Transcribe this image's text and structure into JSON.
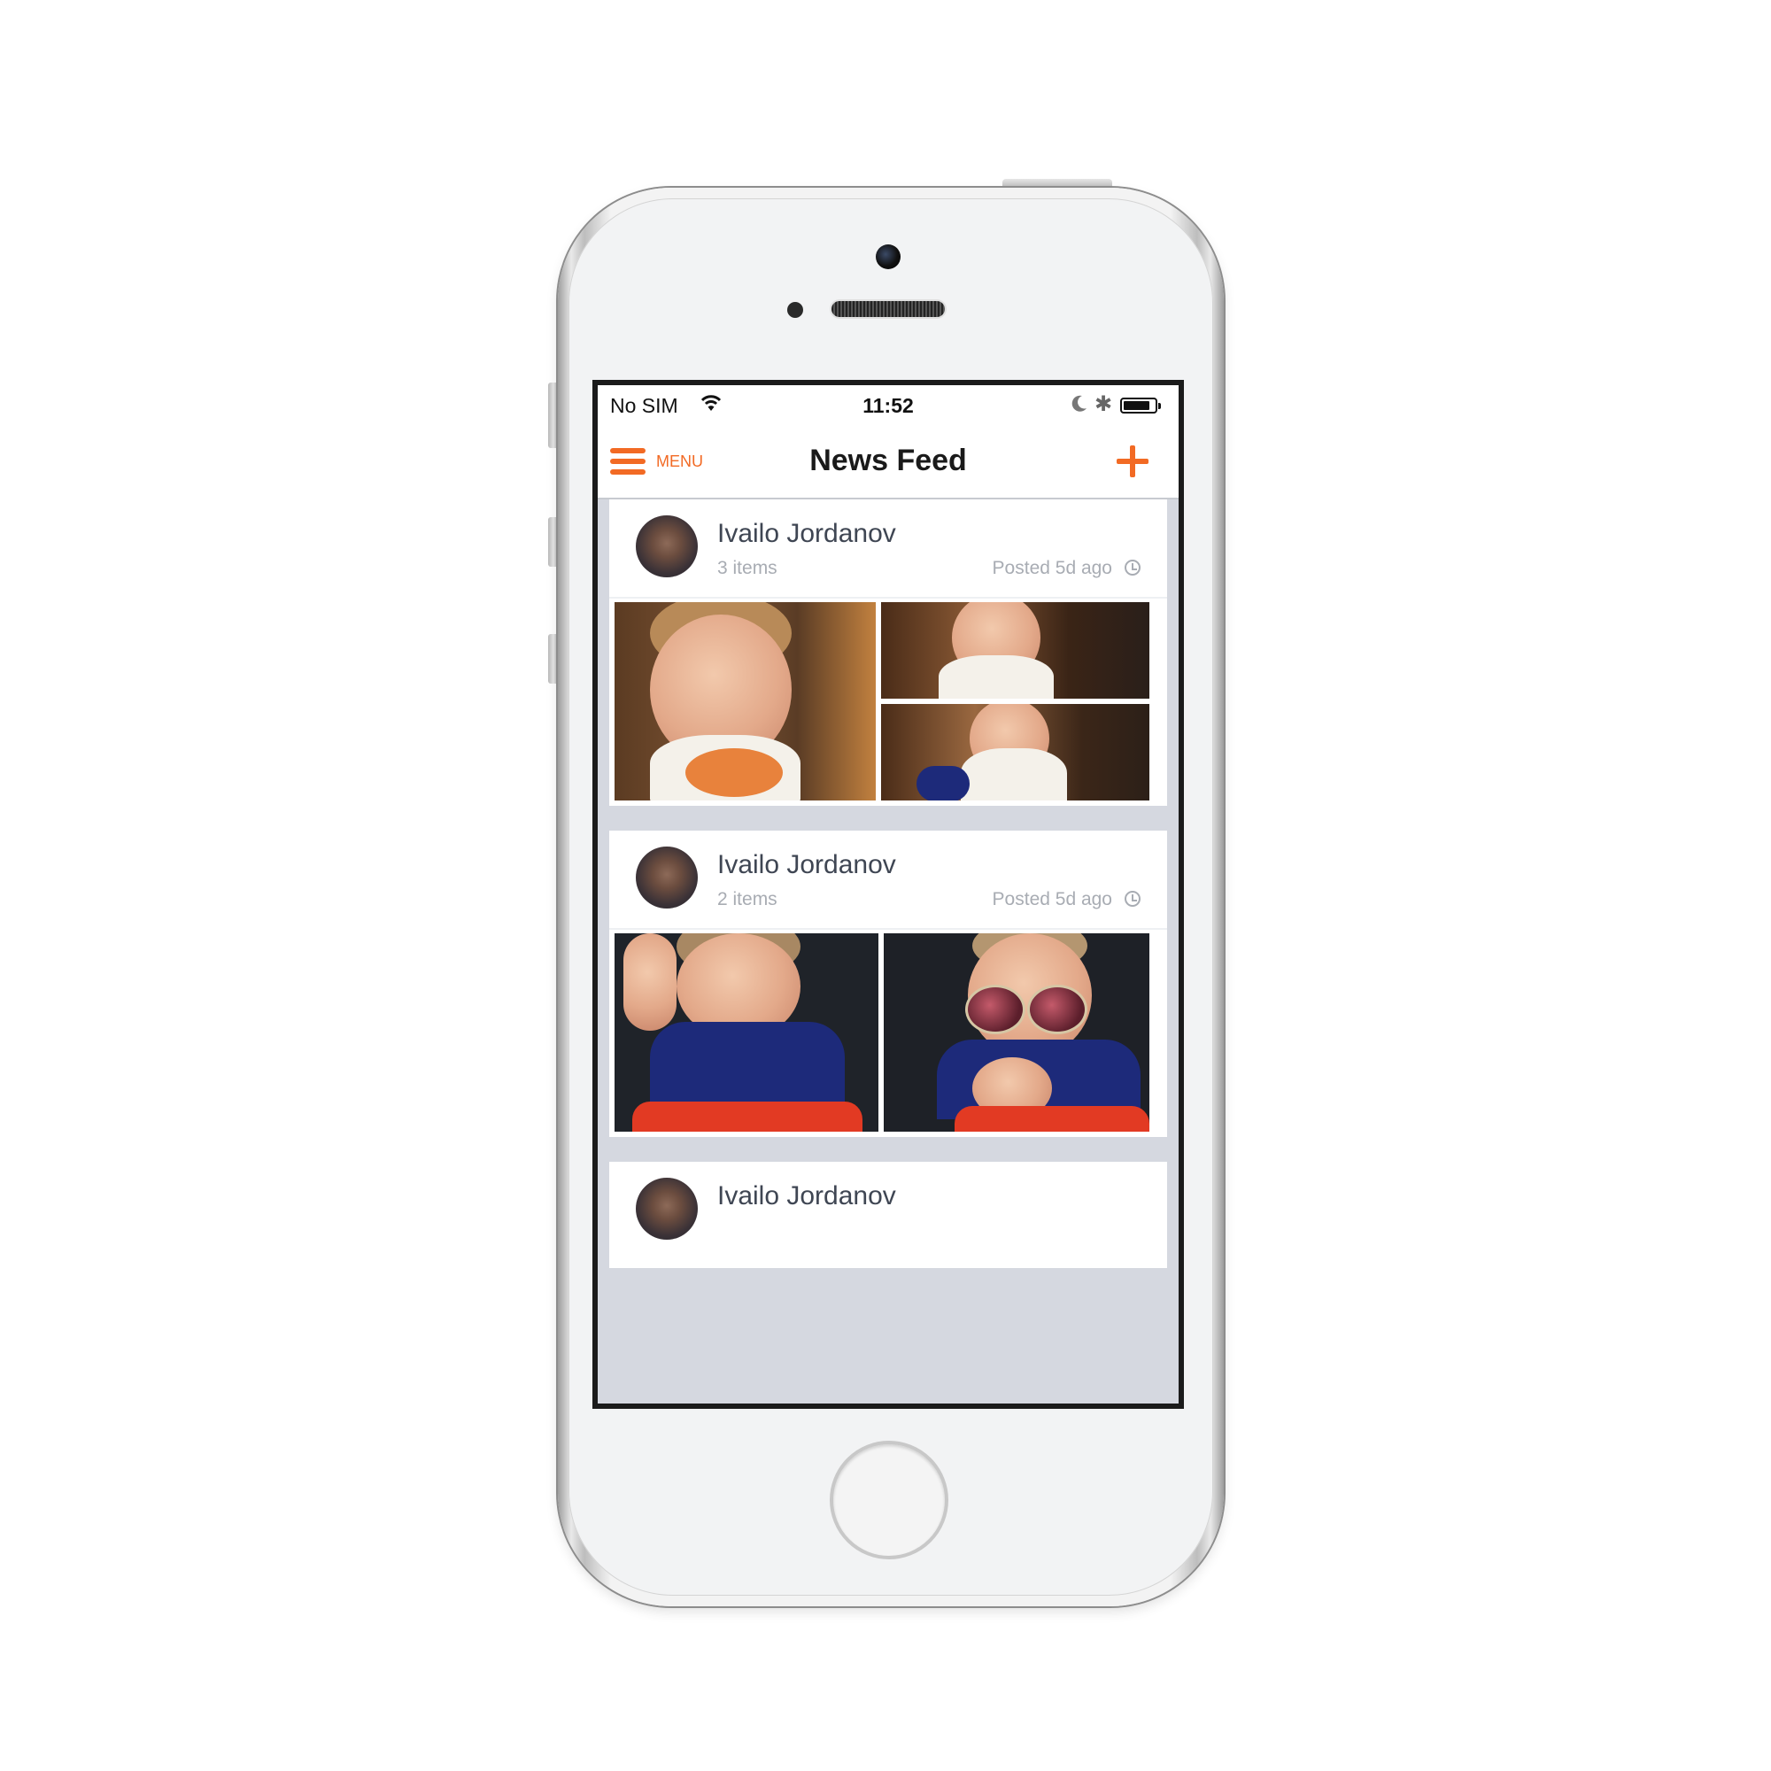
{
  "status_bar": {
    "carrier": "No SIM",
    "time": "11:52",
    "battery_level": 0.85
  },
  "navbar": {
    "menu_label": "MENU",
    "title": "News Feed",
    "accent_color": "#f26a24"
  },
  "posts": [
    {
      "author": "Ivailo Jordanov",
      "items": "3 items",
      "posted": "Posted 5d ago"
    },
    {
      "author": "Ivailo Jordanov",
      "items": "2 items",
      "posted": "Posted 5d ago"
    },
    {
      "author": "Ivailo Jordanov"
    }
  ],
  "icons": [
    "wifi-icon",
    "moon-icon",
    "bluetooth-icon",
    "battery-icon",
    "hamburger-menu-icon",
    "plus-icon",
    "clock-icon"
  ]
}
